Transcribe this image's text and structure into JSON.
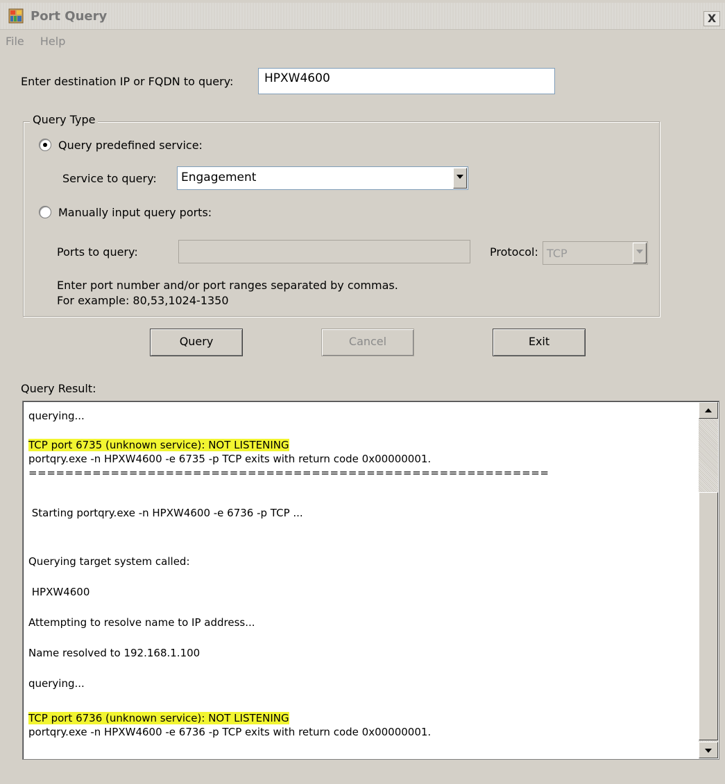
{
  "window": {
    "title": "Port Query",
    "close_symbol": "X"
  },
  "menu": {
    "items": [
      "File",
      "Help"
    ]
  },
  "destination": {
    "label": "Enter destination IP or FQDN to query:",
    "value": "HPXW4600"
  },
  "query_type": {
    "legend": "Query Type",
    "predefined_label": "Query predefined service:",
    "predefined_selected": true,
    "service_label": "Service to query:",
    "service_value": "Engagement",
    "manual_label": "Manually input query ports:",
    "manual_selected": false,
    "ports_label": "Ports to query:",
    "ports_value": "",
    "protocol_label": "Protocol:",
    "protocol_value": "TCP",
    "hint_line1": "Enter port number and/or port ranges separated by commas.",
    "hint_line2": "For example: 80,53,1024-1350"
  },
  "buttons": {
    "query": "Query",
    "cancel": "Cancel",
    "exit": "Exit"
  },
  "result": {
    "label": "Query Result:",
    "lines": [
      "querying...",
      "",
      "TCP port 6735 (unknown service): NOT LISTENING",
      "portqry.exe -n HPXW4600 -e 6735 -p TCP exits with return code 0x00000001.",
      "=========================================================",
      "",
      " Starting portqry.exe -n HPXW4600 -e 6736 -p TCP ...",
      "",
      "",
      "Querying target system called:",
      "",
      " HPXW4600",
      "",
      "Attempting to resolve name to IP address...",
      "",
      "Name resolved to 192.168.1.100",
      "",
      "querying...",
      "",
      "TCP port 6736 (unknown service): NOT LISTENING",
      "portqry.exe -n HPXW4600 -e 6736 -p TCP exits with return code 0x00000001."
    ],
    "highlight_color": "#f2f531"
  },
  "icons": {
    "app": "port-query-app-icon",
    "scroll_up": "scroll-up-arrow-icon",
    "scroll_down": "scroll-down-arrow-icon",
    "dropdown": "dropdown-arrow-icon"
  }
}
